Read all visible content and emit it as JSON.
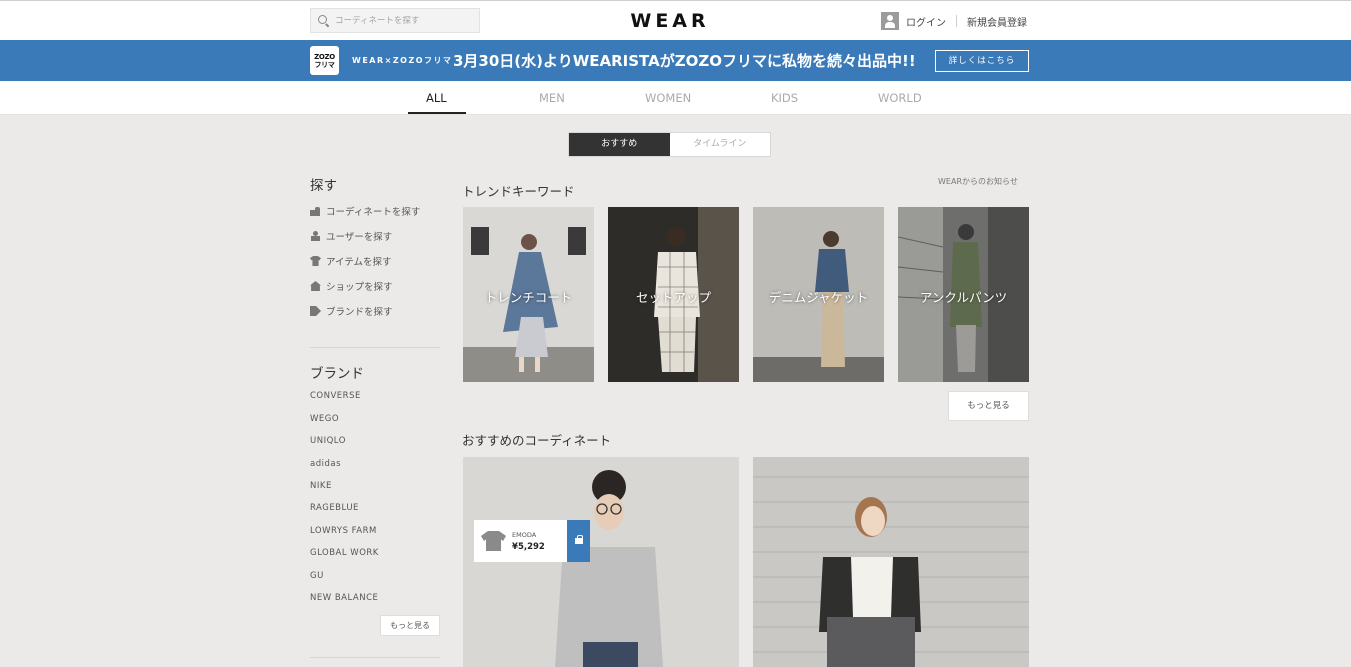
{
  "header": {
    "search_placeholder": "コーディネートを探す",
    "logo": "WEAR",
    "login": "ログイン",
    "register": "新規会員登録"
  },
  "banner": {
    "icon_text_1": "ZOZO",
    "icon_text_2": "フリマ",
    "brand": "WEAR×ZOZOフリマ",
    "message": "3月30日(水)よりWEARISTAがZOZOフリマに私物を続々出品中!!",
    "button": "詳しくはこちら",
    "color": "#3b7ab8"
  },
  "nav": {
    "tabs": [
      {
        "label": "ALL",
        "active": true
      },
      {
        "label": "MEN",
        "active": false
      },
      {
        "label": "WOMEN",
        "active": false
      },
      {
        "label": "KIDS",
        "active": false
      },
      {
        "label": "WORLD",
        "active": false
      }
    ]
  },
  "toggle": {
    "recommended": "おすすめ",
    "timeline": "タイムライン"
  },
  "sidebar": {
    "search_heading": "探す",
    "search_items": [
      {
        "label": "コーディネートを探す",
        "icon": "coordinate-icon"
      },
      {
        "label": "ユーザーを探す",
        "icon": "user-icon"
      },
      {
        "label": "アイテムを探す",
        "icon": "item-icon"
      },
      {
        "label": "ショップを探す",
        "icon": "shop-icon"
      },
      {
        "label": "ブランドを探す",
        "icon": "brand-tag-icon"
      }
    ],
    "brand_heading": "ブランド",
    "brands": [
      "CONVERSE",
      "WEGO",
      "UNIQLO",
      "adidas",
      "NIKE",
      "RAGEBLUE",
      "LOWRYS FARM",
      "GLOBAL WORK",
      "GU",
      "NEW BALANCE"
    ],
    "more": "もっと見る"
  },
  "main": {
    "trend_title": "トレンドキーワード",
    "notice": "WEARからのお知らせ",
    "trends": [
      "トレンチコート",
      "セットアップ",
      "デニムジャケット",
      "アンクルパンツ"
    ],
    "more": "もっと見る",
    "coord_title": "おすすめのコーディネート",
    "item_tag": {
      "brand": "EMODA",
      "price": "¥5,292"
    }
  }
}
